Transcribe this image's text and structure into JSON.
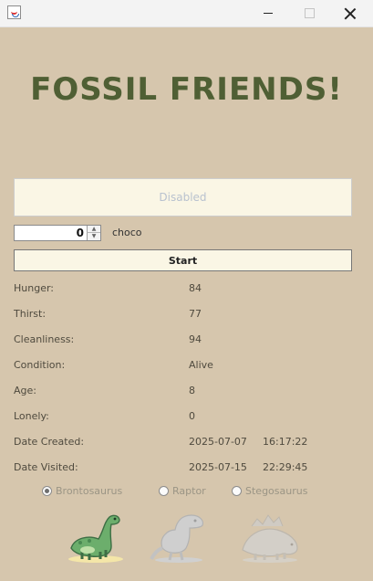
{
  "window": {
    "min_icon": "minimize-icon",
    "max_icon": "maximize-icon",
    "close_icon": "close-icon"
  },
  "app": {
    "title": "FOSSIL FRIENDS!"
  },
  "status_box": {
    "text": "Disabled"
  },
  "controls": {
    "spinner_value": "0",
    "name": "choco",
    "start_label": "Start"
  },
  "stats": [
    {
      "label": "Hunger:",
      "value": "84"
    },
    {
      "label": "Thirst:",
      "value": "77"
    },
    {
      "label": "Cleanliness:",
      "value": "94"
    },
    {
      "label": "Condition:",
      "value": "Alive"
    },
    {
      "label": "Age:",
      "value": "8"
    },
    {
      "label": "Lonely:",
      "value": "0"
    },
    {
      "label": "Date Created:",
      "value": "2025-07-07",
      "time": "16:17:22"
    },
    {
      "label": "Date Visited:",
      "value": "2025-07-15",
      "time": "22:29:45"
    }
  ],
  "species": [
    {
      "label": "Brontosaurus",
      "selected": true
    },
    {
      "label": "Raptor",
      "selected": false
    },
    {
      "label": "Stegosaurus",
      "selected": false
    }
  ],
  "colors": {
    "background": "#d6c6ad",
    "title": "#4f5f34",
    "panel": "#faf6e5"
  }
}
